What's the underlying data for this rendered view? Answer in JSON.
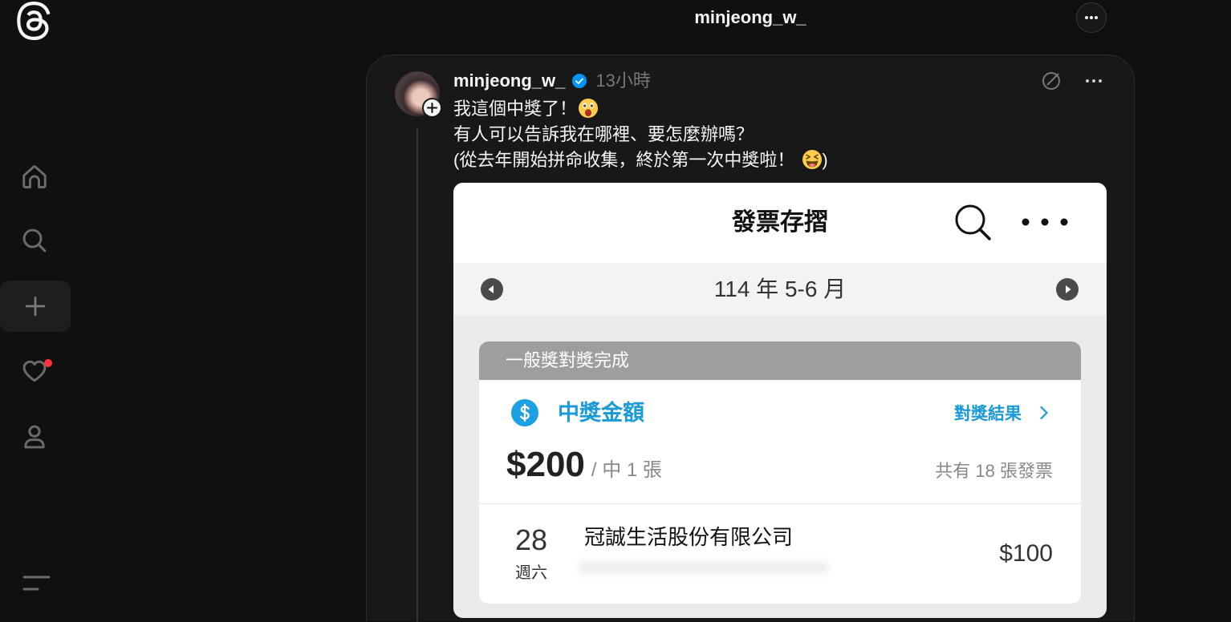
{
  "theme": {
    "page_bg": "#101010",
    "card_bg": "#181818",
    "text": "#f3f5f7",
    "secondary_text": "#777777",
    "verified_blue": "#0095f6",
    "notification_red": "#ff3040"
  },
  "sidebar": {
    "logo_icon": "threads-logo-icon",
    "items": [
      {
        "id": "home",
        "icon": "home-icon"
      },
      {
        "id": "search",
        "icon": "search-icon"
      },
      {
        "id": "create",
        "icon": "plus-icon",
        "highlighted": true
      },
      {
        "id": "activity",
        "icon": "heart-icon",
        "has_notification": true
      },
      {
        "id": "profile",
        "icon": "person-icon"
      }
    ],
    "menu_icon": "menu-icon"
  },
  "header": {
    "title": "minjeong_w_",
    "more_icon": "more-icon"
  },
  "post": {
    "username": "minjeong_w_",
    "verified": true,
    "timestamp": "13小時",
    "action_icons": [
      "circle-slash-icon",
      "more-icon"
    ],
    "text": {
      "line1": "我這個中獎了！",
      "line1_emoji": "astonished-face",
      "line2": "有人可以告訴我在哪裡、要怎麼辦嗎？",
      "line3": "(從去年開始拼命收集，終於第一次中獎啦！",
      "line3_emoji": "grinning-squinting-face",
      "line3_end": ")"
    },
    "image": {
      "app_title": "發票存摺",
      "period": "114 年 5-6 月",
      "status_banner": "一般獎對獎完成",
      "prize_label": "中獎金額",
      "result_link": "對獎結果",
      "prize_amount": "$200",
      "prize_count": "/ 中 1 張",
      "total_invoices": "共有 18 張發票",
      "invoice": {
        "day": "28",
        "weekday": "週六",
        "merchant": "冠誠生活股份有限公司",
        "amount": "$100"
      },
      "accent_color": "#1a9ad6",
      "banner_color": "#9e9e9e"
    }
  }
}
